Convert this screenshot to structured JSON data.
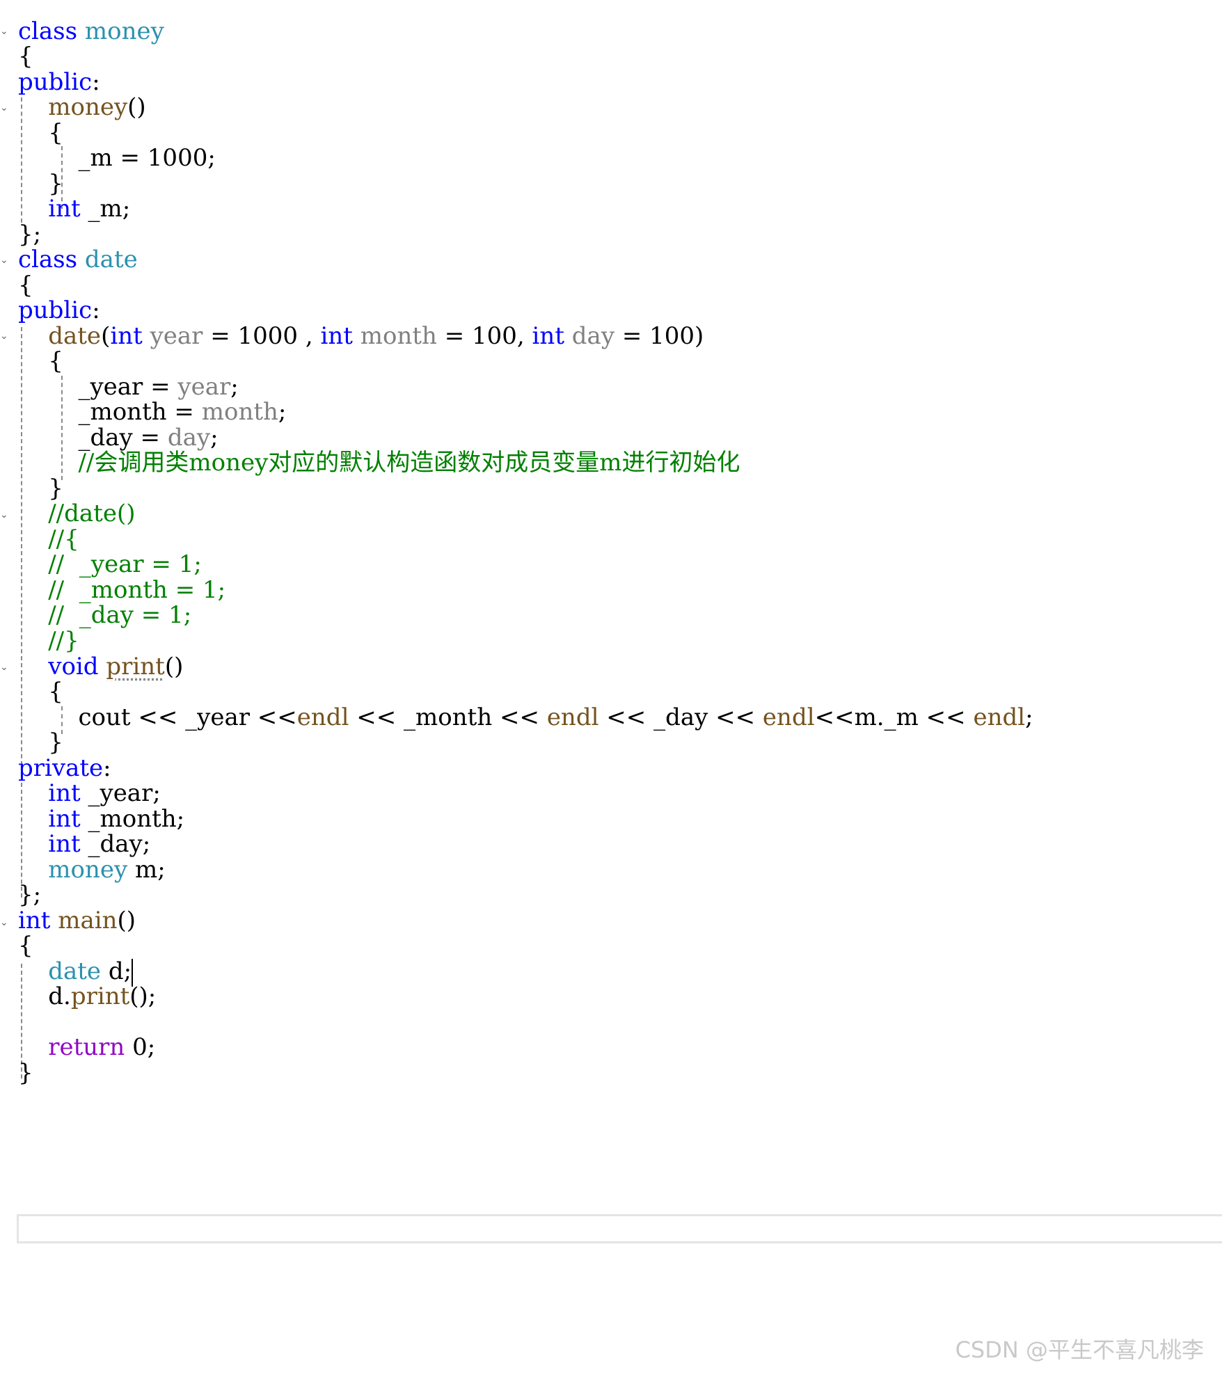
{
  "code_lines": [
    "class money",
    "{",
    "public:",
    "    money()",
    "    {",
    "        _m = 1000;",
    "    }",
    "    int _m;",
    "};",
    "class date",
    "{",
    "public:",
    "    date(int year = 1000 , int month = 100, int day = 100)",
    "    {",
    "        _year = year;",
    "        _month = month;",
    "        _day = day;",
    "        //会调用类money对应的默认构造函数对成员变量m进行初始化",
    "    }",
    "    //date()",
    "    //{",
    "    //  _year = 1;",
    "    //  _month = 1;",
    "    //  _day = 1;",
    "    //}",
    "    void print()",
    "    {",
    "        cout << _year <<endl << _month << endl << _day << endl<<m._m << endl;",
    "    }",
    "private:",
    "    int _year;",
    "    int _month;",
    "    int _day;",
    "    money m;",
    "};",
    "int main()",
    "{",
    "    date d;",
    "    d.print();",
    "",
    "    return 0;",
    "}"
  ],
  "tokens": {
    "class": "class",
    "public": "public",
    "private": "private",
    "int": "int",
    "void": "void",
    "return": "return",
    "money": "money",
    "date": "date",
    "print": "print",
    "main": "main",
    "cout": "cout",
    "endl": "endl",
    "year": "year",
    "month": "month",
    "day": "day"
  },
  "watermark": "CSDN @平生不喜凡桃李"
}
